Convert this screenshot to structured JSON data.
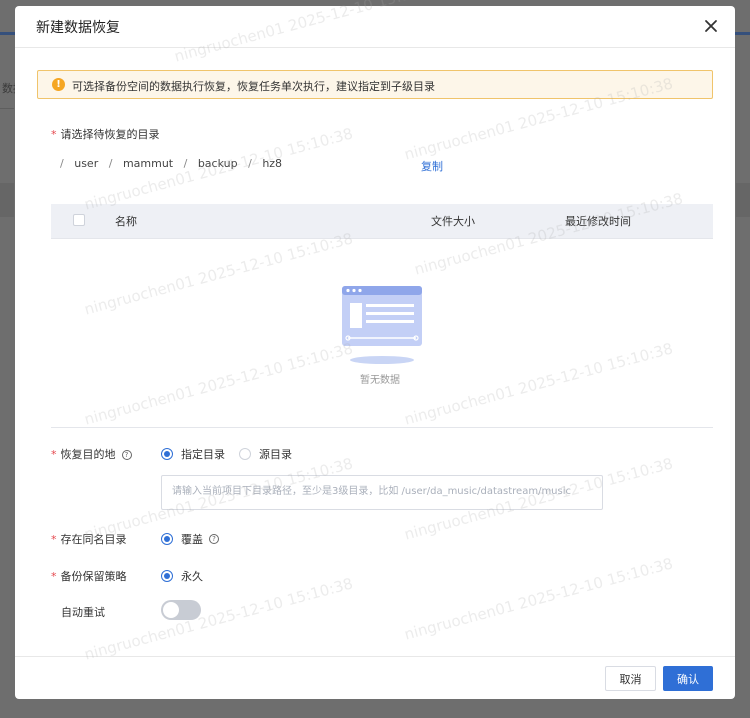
{
  "background": {
    "partial_text": "数据"
  },
  "dialog": {
    "title": "新建数据恢复",
    "alert_text": "可选择备份空间的数据执行恢复，恢复任务单次执行，建议指定到子级目录",
    "select_dir_label": "请选择待恢复的目录",
    "breadcrumb": [
      "user",
      "mammut",
      "backup",
      "hz8"
    ],
    "copy_label": "复制",
    "table": {
      "columns": [
        "名称",
        "文件大小",
        "最近修改时间"
      ],
      "empty_text": "暂无数据"
    },
    "destination": {
      "label": "恢复目的地",
      "options": [
        "指定目录",
        "源目录"
      ],
      "selected": "指定目录",
      "path_placeholder": "请输入当前项目下目录路径，至少是3级目录，比如 /user/da_music/datastream/music"
    },
    "same_name": {
      "label": "存在同名目录",
      "option": "覆盖"
    },
    "retention": {
      "label": "备份保留策略",
      "option": "永久"
    },
    "auto_retry": {
      "label": "自动重试",
      "enabled": false
    },
    "buttons": {
      "cancel": "取消",
      "confirm": "确认"
    }
  },
  "watermark_text": "ningruochen01 2025-12-10 15:10:38",
  "colors": {
    "primary": "#2f6fd6",
    "required": "#e5484d",
    "warning": "#f5a623"
  }
}
